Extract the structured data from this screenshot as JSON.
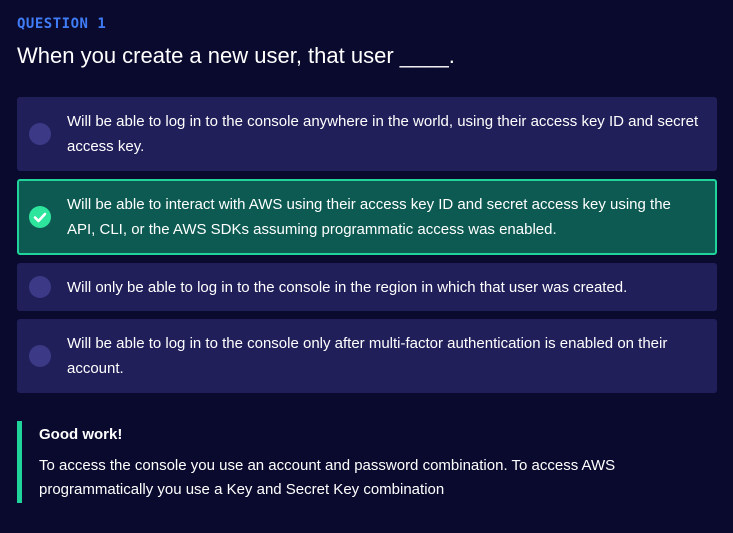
{
  "question": {
    "label": "QUESTION 1",
    "text": "When you create a new user, that user ____."
  },
  "options": [
    {
      "text": "Will be able to log in to the console anywhere in the world, using their access key ID and secret access key.",
      "state": "unselected"
    },
    {
      "text": "Will be able to interact with AWS using their access key ID and secret access key using the API, CLI, or the AWS SDKs assuming programmatic access was enabled.",
      "state": "correct"
    },
    {
      "text": "Will only be able to log in to the console in the region in which that user was created.",
      "state": "unselected"
    },
    {
      "text": "Will be able to log in to the console only after multi-factor authentication is enabled on their account.",
      "state": "unselected"
    }
  ],
  "feedback": {
    "title": "Good work!",
    "body": "To access the console you use an account and password combination. To access AWS programmatically you use a Key and Secret Key combination"
  },
  "colors": {
    "background": "#0a0a2e",
    "accent": "#3f7cf6",
    "option_background": "#211f5a",
    "correct_background": "#0c5a52",
    "correct_border": "#1fd39a"
  },
  "icons": {
    "radio": "radio-circle-icon",
    "check": "checkmark-circle-icon"
  }
}
